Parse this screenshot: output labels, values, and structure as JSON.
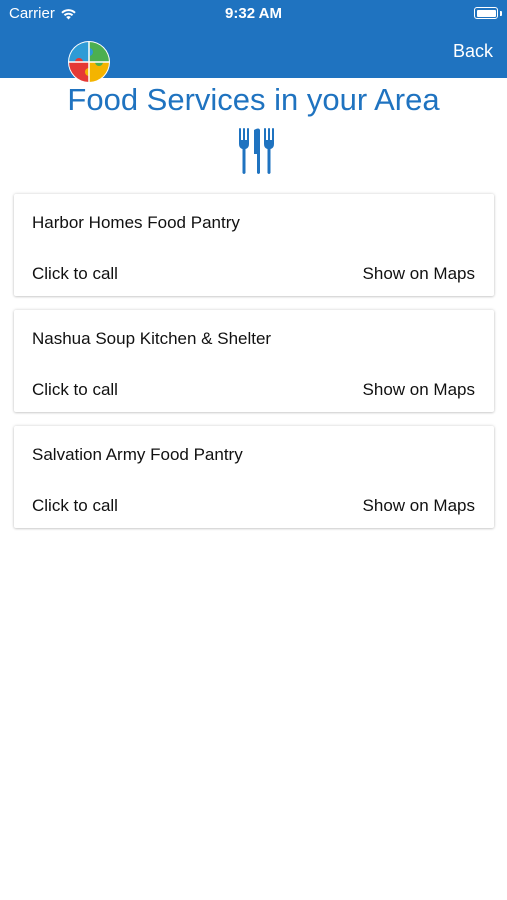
{
  "status_bar": {
    "carrier": "Carrier",
    "time": "9:32 AM",
    "wifi_icon": "wifi-icon",
    "battery_icon": "battery-icon"
  },
  "nav": {
    "logo_icon": "puzzle-logo-icon",
    "back_label": "Back"
  },
  "header": {
    "title": "Food Services in your Area",
    "icon": "fork-knife-icon"
  },
  "services": [
    {
      "name": "Harbor Homes Food Pantry",
      "call_label": "Click to call",
      "maps_label": "Show on Maps"
    },
    {
      "name": "Nashua Soup Kitchen & Shelter",
      "call_label": "Click to call",
      "maps_label": "Show on Maps"
    },
    {
      "name": "Salvation Army Food Pantry",
      "call_label": "Click to call",
      "maps_label": "Show on Maps"
    }
  ],
  "colors": {
    "accent": "#1f73c0",
    "nav_text": "#ffffff",
    "card_text": "#111111"
  }
}
